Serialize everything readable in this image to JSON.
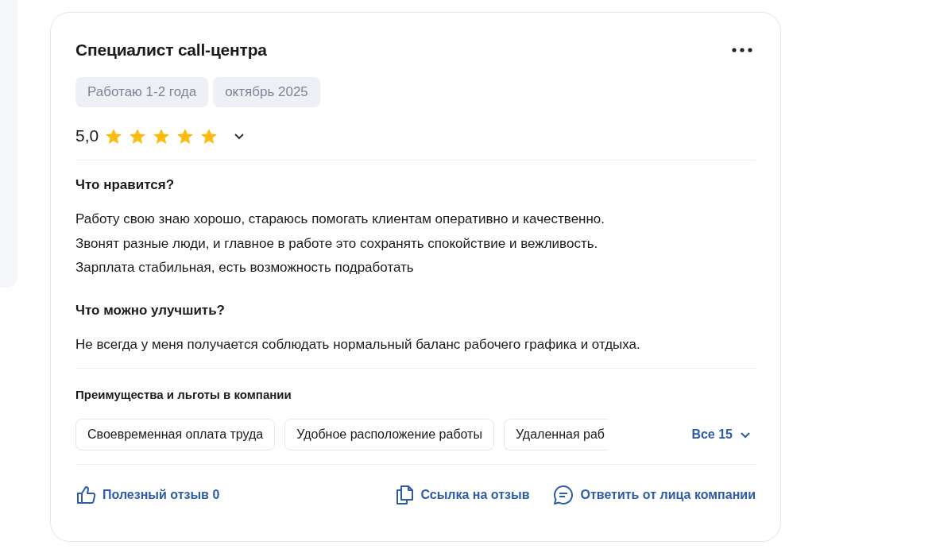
{
  "review": {
    "title": "Специалист call-центра",
    "tags": [
      "Работаю 1-2 года",
      "октябрь 2025"
    ],
    "rating": "5,0",
    "stars": 5,
    "sections": [
      {
        "heading": "Что нравится?",
        "lines": [
          "Работу свою знаю хорошо, стараюсь помогать клиентам оперативно и качественно.",
          "Звонят разные люди, и главное в работе это сохранять спокойствие и вежливость.",
          "Зарплата стабильная, есть возможность подработать"
        ]
      },
      {
        "heading": "Что можно улучшить?",
        "lines": [
          "Не всегда у меня получается соблюдать нормальный баланс рабочего графика и отдыха."
        ]
      }
    ],
    "benefits": {
      "heading": "Преимущества и льготы в компании",
      "items": [
        "Своевременная оплата труда",
        "Удобное расположение работы",
        "Удаленная раб"
      ],
      "more": "Все 15"
    },
    "actions": [
      {
        "kind": "like",
        "label": "Полезный отзыв 0"
      },
      {
        "kind": "link",
        "label": "Ссылка на отзыв"
      },
      {
        "kind": "reply",
        "label": "Ответить от лица компании"
      }
    ]
  }
}
